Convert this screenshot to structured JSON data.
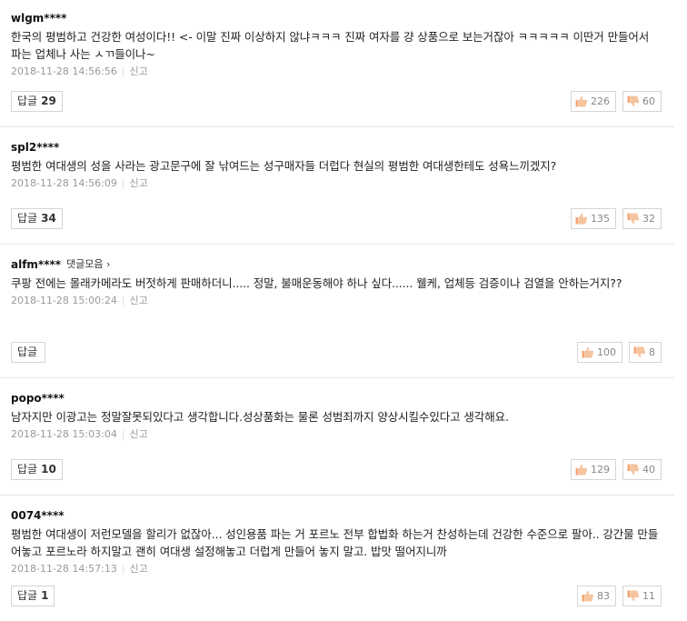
{
  "comments": [
    {
      "user": "wlgm****",
      "text": "한국의 평범하고 건강한 여성이다!! <- 이말 진짜 이상하지 않냐ㅋㅋㅋ 진짜 여자를 걍 상품으로 보는거잖아 ㅋㅋㅋㅋㅋ 이딴거 만들어서 파는 업체나 사는 ㅅㄲ들이나~",
      "time": "2018-11-28 14:56:56",
      "report": "신고",
      "reply_label": "답글",
      "reply_count": "29",
      "likes": "226",
      "dislikes": "60"
    },
    {
      "user": "spl2****",
      "text": "평범한 여대생의 성을 사라는 광고문구에 잘 낚여드는 성구매자들 더럽다 현실의 평범한 여대생한테도 성욕느끼겠지?",
      "time": "2018-11-28 14:56:09",
      "report": "신고",
      "reply_label": "답글",
      "reply_count": "34",
      "likes": "135",
      "dislikes": "32"
    },
    {
      "user": "alfm****",
      "extra": "댓글모음",
      "text": "쿠팡 전에는 몰래카메라도 버젓하게 판매하더니..... 정말, 불매운동해야 하나 싶다...... 웰케, 업체등 검증이나 검열을 안하는거지??",
      "time": "2018-11-28 15:00:24",
      "report": "신고",
      "reply_label": "답글",
      "reply_count": "",
      "likes": "100",
      "dislikes": "8"
    },
    {
      "user": "popo****",
      "text": "남자지만 이광고는 정말잘못되있다고 생각합니다.성상품화는 물론 성범죄까지 양상시킬수있다고 생각해요.",
      "time": "2018-11-28 15:03:04",
      "report": "신고",
      "reply_label": "답글",
      "reply_count": "10",
      "likes": "129",
      "dislikes": "40"
    },
    {
      "user": "0074****",
      "text": "평범한 여대생이 저런모델을 할리가 없잖아... 성인용품 파는 거 포르노 전부 합법화 하는거 찬성하는데 건강한 수준으로 팔아.. 강간물 만들어놓고 포르노라 하지말고 괜히 여대생 설정해놓고 더럽게 만들어 놓지 말고. 밥맛 떨어지니까",
      "time": "2018-11-28 14:57:13",
      "report": "신고",
      "reply_label": "답글",
      "reply_count": "1",
      "likes": "83",
      "dislikes": "11"
    }
  ],
  "icons": {
    "like": "thumbs-up-icon",
    "dislike": "thumbs-down-icon",
    "more": "chevron-right-icon"
  },
  "colors": {
    "like": "#f2a774",
    "dislike": "#f2a774",
    "border": "#d5d5d5",
    "meta": "#999999"
  }
}
